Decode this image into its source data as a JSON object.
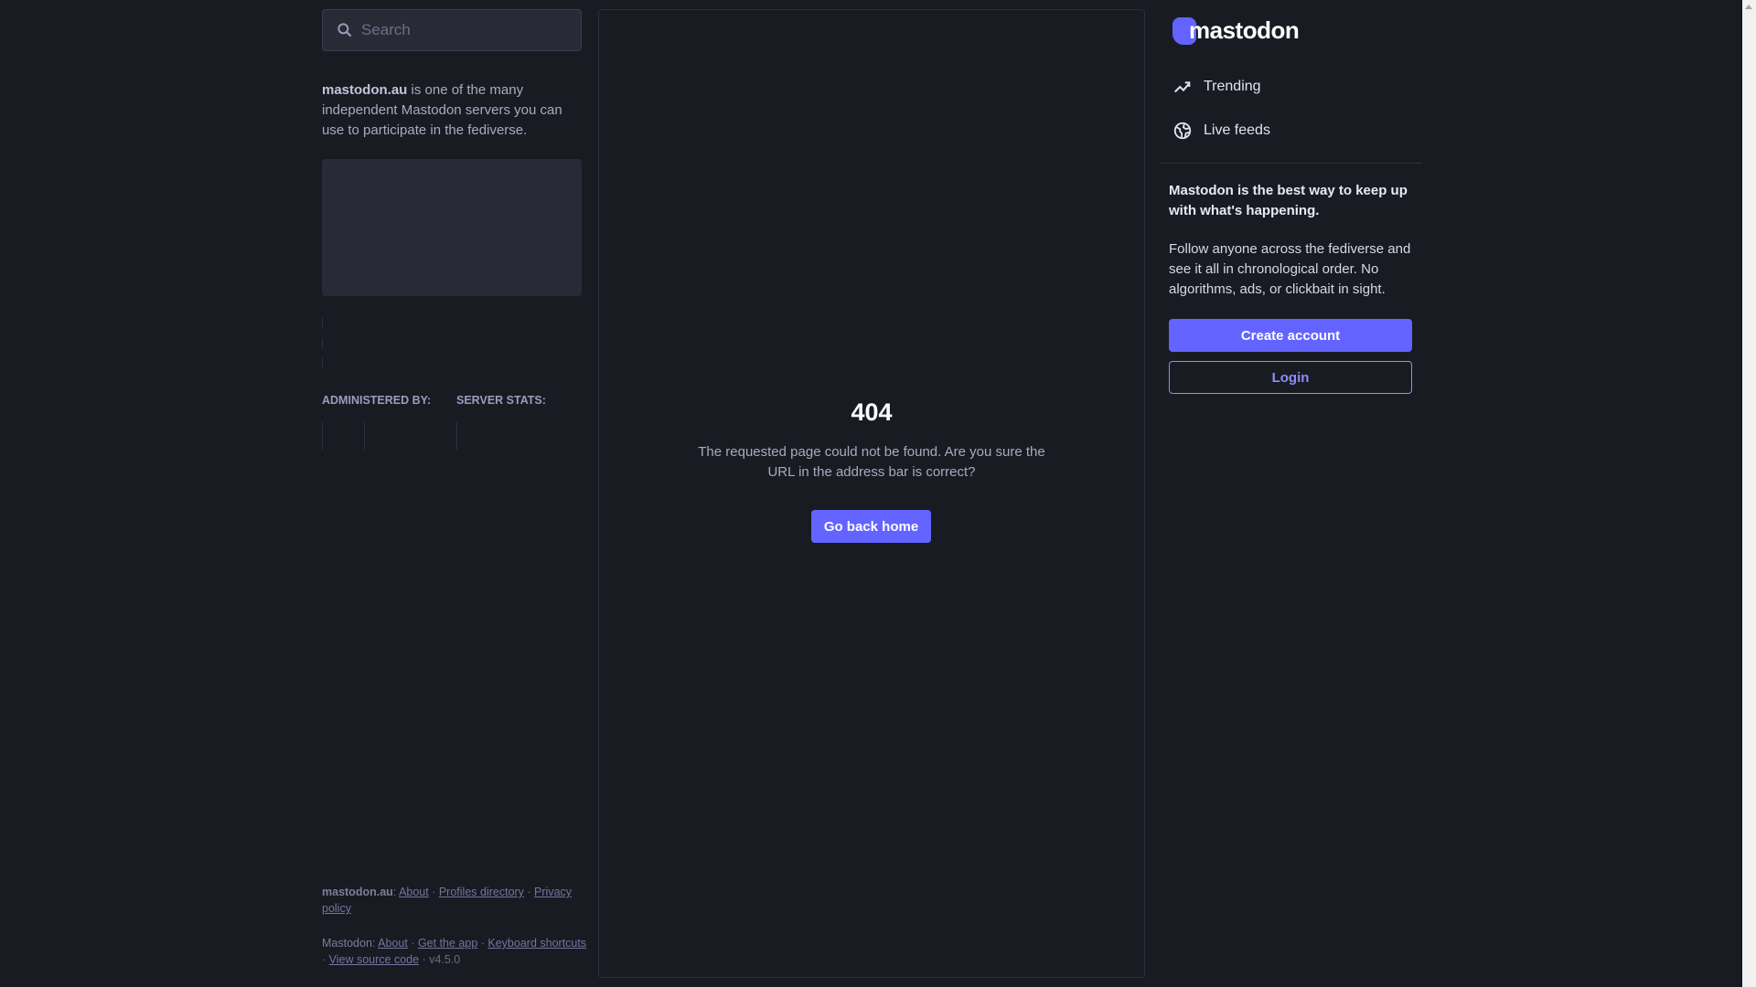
{
  "search": {
    "placeholder": "Search"
  },
  "about": {
    "server": "mastodon.au",
    "text": " is one of the many independent Mastodon servers you can use to participate in the fediverse."
  },
  "sections": {
    "administered_by": "ADMINISTERED BY:",
    "server_stats": "SERVER STATS:"
  },
  "error": {
    "code": "404",
    "message": "The requested page could not be found. Are you sure the URL in the address bar is correct?",
    "button": "Go back home"
  },
  "sidebar": {
    "logo": "mastodon",
    "nav": [
      {
        "label": "Trending",
        "icon": "trending-icon"
      },
      {
        "label": "Live feeds",
        "icon": "globe-icon"
      }
    ],
    "tagline": "Mastodon is the best way to keep up with what's happening.",
    "description": "Follow anyone across the fediverse and see it all in chronological order. No algorithms, ads, or clickbait in sight.",
    "create_account": "Create account",
    "login": "Login"
  },
  "footer": {
    "server": {
      "name": "mastodon.au",
      "links": [
        "About",
        "Profiles directory",
        "Privacy policy"
      ]
    },
    "mastodon": {
      "name": "Mastodon",
      "links": [
        "About",
        "Get the app",
        "Keyboard shortcuts",
        "View source code"
      ],
      "version": "v4.5.0"
    }
  },
  "colors": {
    "accent": "#6364ff",
    "background": "#191b22"
  }
}
